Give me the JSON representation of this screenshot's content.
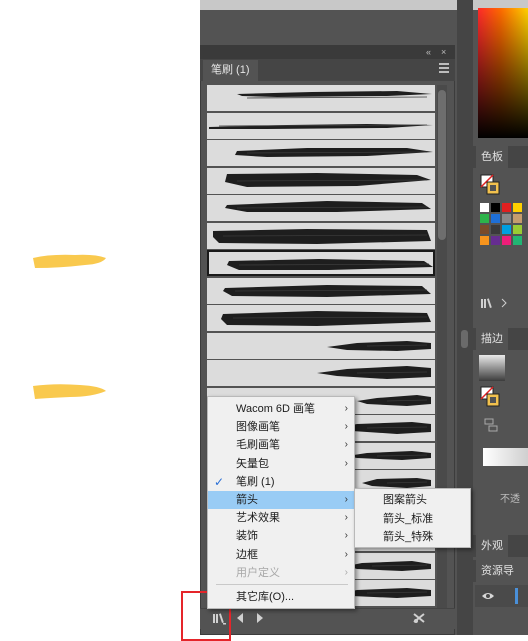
{
  "canvas": {
    "strokes": [
      {
        "name": "yellow-stroke-1",
        "color": "#F9C94E"
      },
      {
        "name": "yellow-stroke-2",
        "color": "#F9C94E"
      }
    ]
  },
  "brush_panel": {
    "tab_label": "笔刷 (1)",
    "titlebar_controls": [
      "«",
      "×"
    ],
    "brush_count_visible": 20,
    "selected_brush_index": 6
  },
  "context_menu": {
    "items": [
      {
        "label": "Wacom 6D 画笔",
        "has_submenu": true,
        "checked": false,
        "highlighted": false,
        "disabled": false
      },
      {
        "label": "图像画笔",
        "has_submenu": true,
        "checked": false,
        "highlighted": false,
        "disabled": false
      },
      {
        "label": "毛刷画笔",
        "has_submenu": true,
        "checked": false,
        "highlighted": false,
        "disabled": false
      },
      {
        "label": "矢量包",
        "has_submenu": true,
        "checked": false,
        "highlighted": false,
        "disabled": false
      },
      {
        "label": "笔刷 (1)",
        "has_submenu": false,
        "checked": true,
        "highlighted": false,
        "disabled": false
      },
      {
        "label": "箭头",
        "has_submenu": true,
        "checked": false,
        "highlighted": true,
        "disabled": false
      },
      {
        "label": "艺术效果",
        "has_submenu": true,
        "checked": false,
        "highlighted": false,
        "disabled": false
      },
      {
        "label": "装饰",
        "has_submenu": true,
        "checked": false,
        "highlighted": false,
        "disabled": false
      },
      {
        "label": "边框",
        "has_submenu": true,
        "checked": false,
        "highlighted": false,
        "disabled": false
      },
      {
        "label": "用户定义",
        "has_submenu": true,
        "checked": false,
        "highlighted": false,
        "disabled": true
      }
    ],
    "other_library_label": "其它库(O)...",
    "check_glyph": "✓",
    "arrow_glyph": "›",
    "submenu": {
      "items": [
        "图案箭头",
        "箭头_标准",
        "箭头_特殊"
      ]
    }
  },
  "right_panels": {
    "swatches_tab": "色板",
    "stroke_tab": "描边",
    "appearance_tab": "外观",
    "asset_export_tab": "资源导出",
    "opacity_label": "不透",
    "swatch_colors": [
      "#ffffff",
      "#000000",
      "#e02020",
      "#ffd000",
      "#2db34a",
      "#1e6fd6",
      "#8a8a8a",
      "#c69c6d",
      "#7a4a2a",
      "#3a3a3a",
      "#00a0e0",
      "#99cc33",
      "#f7941d",
      "#662d91",
      "#ed1e79",
      "#22b573"
    ],
    "accent": "#4a90d9"
  },
  "bottom_bar": {
    "icons": [
      "library-menu-icon",
      "prev-library-icon",
      "next-library-icon",
      "remove-brush-icon"
    ]
  }
}
